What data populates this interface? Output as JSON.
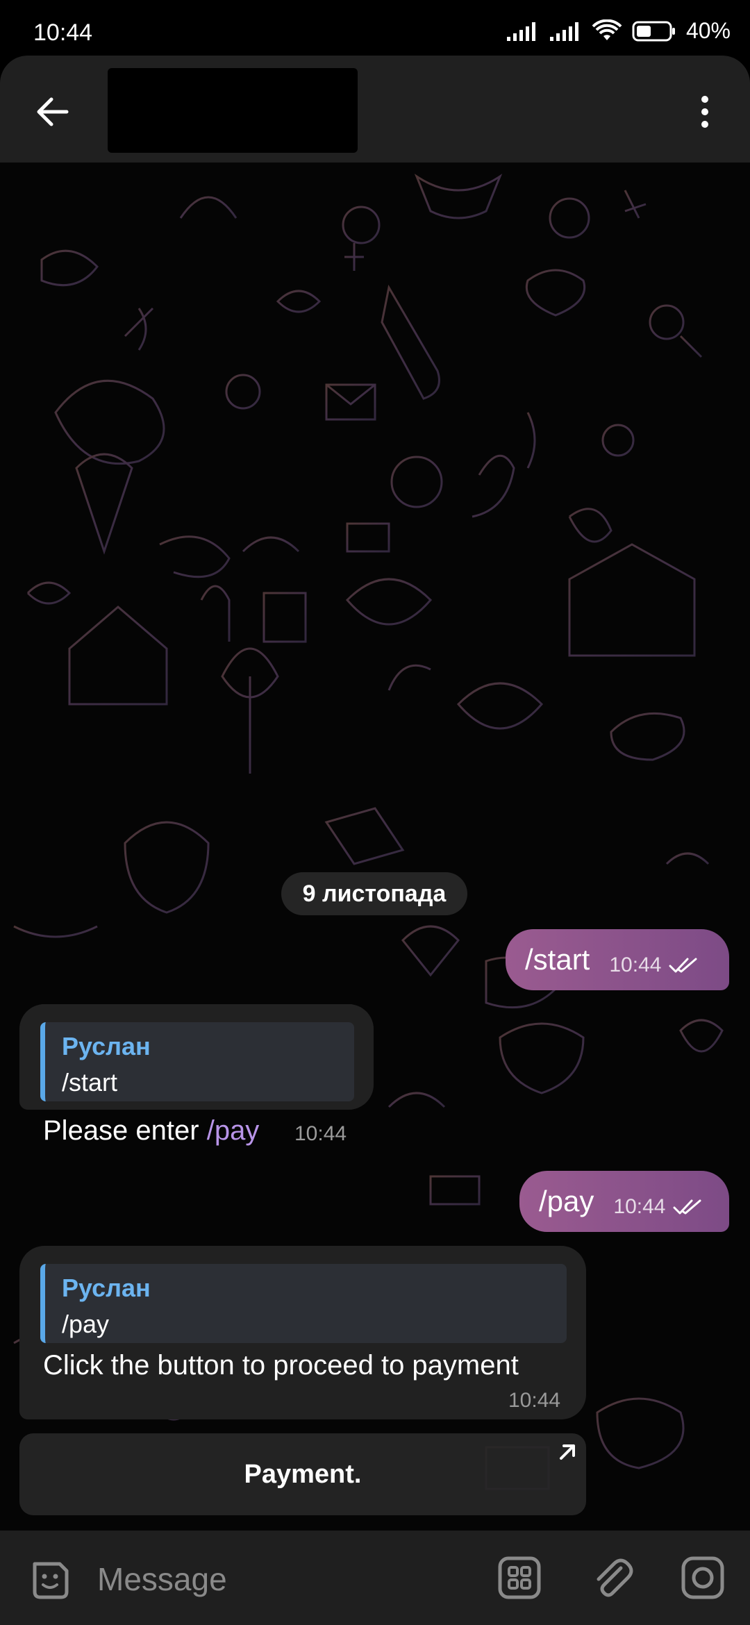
{
  "status_bar": {
    "time": "10:44",
    "battery": "40%"
  },
  "header": {
    "back_icon": "arrow-left-icon",
    "menu_icon": "more-vertical-icon"
  },
  "chat": {
    "date_separator": "9 листопада",
    "messages": [
      {
        "direction": "outgoing",
        "text": "/start",
        "time": "10:44",
        "status": "read"
      },
      {
        "direction": "incoming",
        "reply_name": "Руслан",
        "reply_text": "/start",
        "text_prefix": "Please enter ",
        "text_command": "/pay",
        "time": "10:44"
      },
      {
        "direction": "outgoing",
        "text": "/pay",
        "time": "10:44",
        "status": "read"
      },
      {
        "direction": "incoming",
        "reply_name": "Руслан",
        "reply_text": "/pay",
        "text": "Click the button to proceed to payment",
        "time": "10:44"
      }
    ],
    "inline_button": {
      "label": "Payment."
    }
  },
  "composer": {
    "placeholder": "Message"
  },
  "colors": {
    "outgoing_bubble": "#8e5689",
    "incoming_bubble": "#212121",
    "reply_accent": "#5aa8e8",
    "command_link": "#b894e8"
  }
}
